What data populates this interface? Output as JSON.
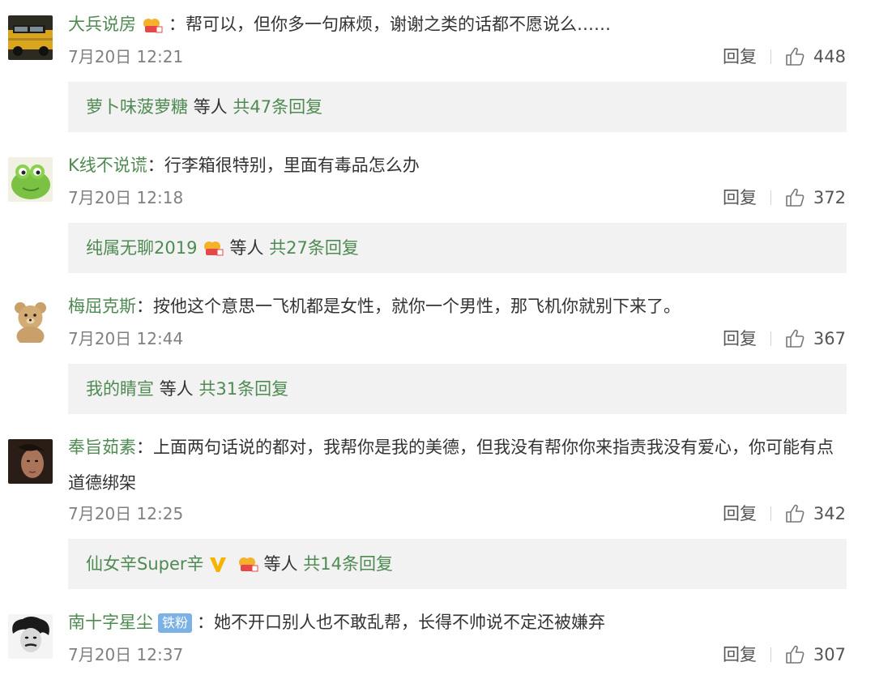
{
  "comments": [
    {
      "user": "大兵说房",
      "sep": "：",
      "content": "帮可以，但你多一句麻烦，谢谢之类的话都不愿说么……",
      "time": "7月20日 12:21",
      "reply_label": "回复",
      "likes": "448",
      "avatar_icon": "car-avatar",
      "reply_preview": {
        "user": "萝卜味菠萝糖",
        "others": "等人",
        "count": "共47条回复"
      }
    },
    {
      "user": "K线不说谎",
      "sep": "：",
      "content": "行李箱很特别，里面有毒品怎么办",
      "time": "7月20日 12:18",
      "reply_label": "回复",
      "likes": "372",
      "avatar_icon": "green-frog-avatar",
      "reply_preview": {
        "user": "纯属无聊2019",
        "others": "等人",
        "count": "共27条回复"
      }
    },
    {
      "user": "梅屈克斯",
      "sep": "：",
      "content": "按他这个意思一飞机都是女性，就你一个男性，那飞机你就别下来了。",
      "time": "7月20日 12:44",
      "reply_label": "回复",
      "likes": "367",
      "avatar_icon": "teddy-bear-avatar",
      "reply_preview": {
        "user": "我的睛宣",
        "others": "等人",
        "count": "共31条回复"
      }
    },
    {
      "user": "奉旨茹素",
      "sep": "：",
      "content": "上面两句话说的都对，我帮你是我的美德，但我没有帮你你来指责我没有爱心，你可能有点道德绑架",
      "time": "7月20日 12:25",
      "reply_label": "回复",
      "likes": "342",
      "avatar_icon": "portrait-avatar",
      "reply_preview": {
        "user": "仙女辛Super辛",
        "others": "等人",
        "count": "共14条回复"
      }
    },
    {
      "user": "南十字星尘",
      "badge": "铁粉",
      "sep": "：",
      "content": "她不开口别人也不敢乱帮，长得不帅说不定还被嫌弃",
      "time": "7月20日 12:37",
      "reply_label": "回复",
      "likes": "307",
      "avatar_icon": "einstein-avatar"
    }
  ],
  "colors": {
    "username": "#4f8a52",
    "meta": "#808080",
    "reply_bg": "#f2f2f2",
    "fan_badge": "#7cb1e6",
    "vip": "#f4b400"
  }
}
